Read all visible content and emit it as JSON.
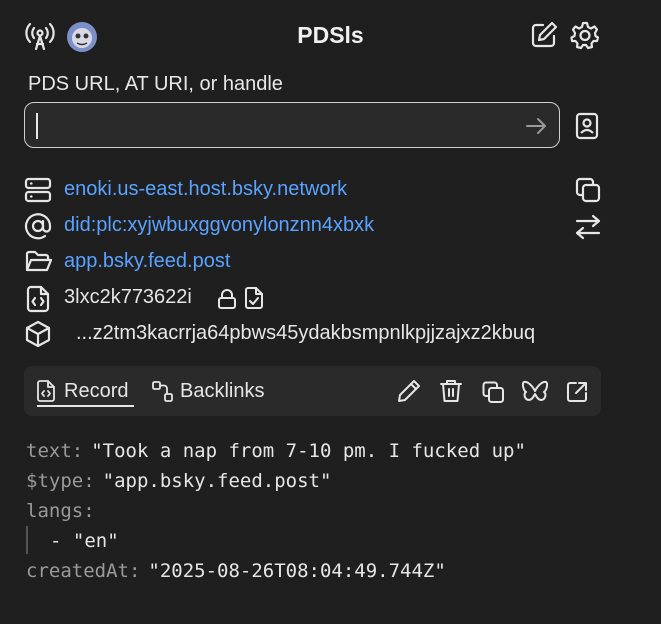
{
  "header": {
    "title": "PDSls"
  },
  "search": {
    "label": "PDS URL, AT URI, or handle",
    "value": "",
    "placeholder": ""
  },
  "info": {
    "pds": "enoki.us-east.host.bsky.network",
    "did": "did:plc:xyjwbuxggvonylonznn4xbxk",
    "collection": "app.bsky.feed.post",
    "rkey": "3lxc2k773622i",
    "cid": "...z2tm3kacrrja64pbws45ydakbsmpnlkpjjzajxz2kbuq"
  },
  "tabs": [
    {
      "label": "Record",
      "active": true
    },
    {
      "label": "Backlinks",
      "active": false
    }
  ],
  "record": {
    "text_key": "text:",
    "text_val": "\"Took a nap from 7-10 pm. I fucked up\"",
    "type_key": "$type:",
    "type_val": "\"app.bsky.feed.post\"",
    "langs_key": "langs:",
    "langs_item": "- \"en\"",
    "created_key": "createdAt:",
    "created_val": "\"2025-08-26T08:04:49.744Z\""
  },
  "colors": {
    "background": "#1f1f1f",
    "link": "#5aa2ff",
    "panel": "#2a2a2a"
  }
}
